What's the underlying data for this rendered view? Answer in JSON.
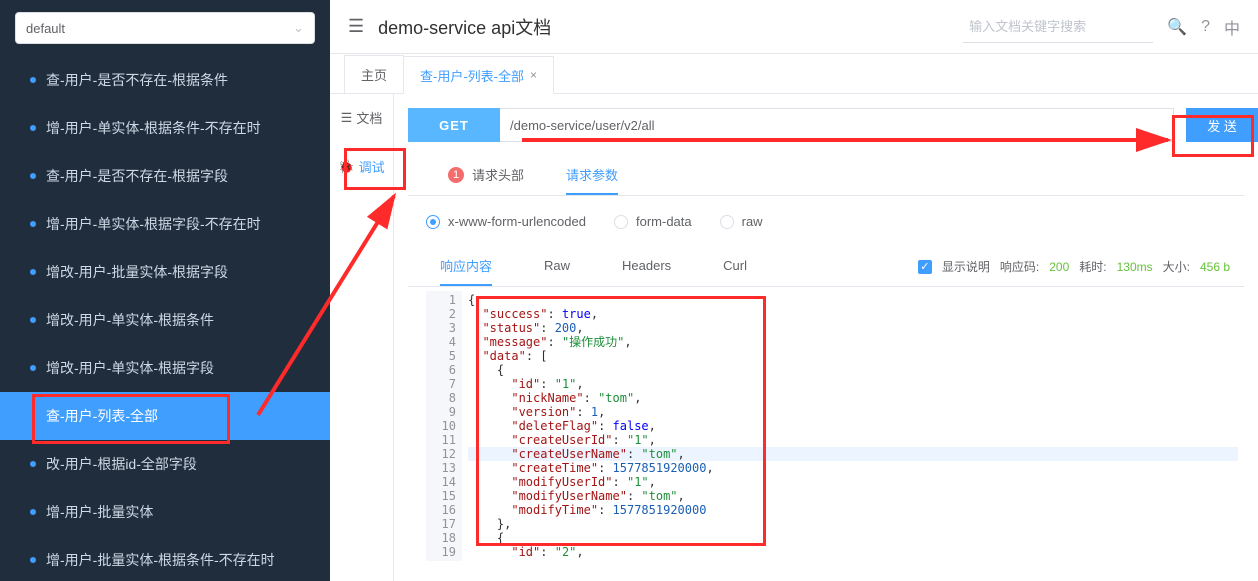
{
  "sidebar": {
    "selector_value": "default",
    "items": [
      "查-用户-是否不存在-根据条件",
      "增-用户-单实体-根据条件-不存在时",
      "查-用户-是否不存在-根据字段",
      "增-用户-单实体-根据字段-不存在时",
      "增改-用户-批量实体-根据字段",
      "增改-用户-单实体-根据条件",
      "增改-用户-单实体-根据字段",
      "查-用户-列表-全部",
      "改-用户-根据id-全部字段",
      "增-用户-批量实体",
      "增-用户-批量实体-根据条件-不存在时"
    ],
    "active_index": 7
  },
  "header": {
    "title": "demo-service api文档",
    "search_placeholder": "输入文档关键字搜索",
    "lang_label": "中"
  },
  "tabs": [
    {
      "label": "主页",
      "closable": false
    },
    {
      "label": "查-用户-列表-全部",
      "closable": true
    }
  ],
  "tabs_active": 1,
  "side_tabs": {
    "doc": "文档",
    "debug": "调试",
    "active": "debug"
  },
  "request": {
    "method": "GET",
    "url": "/demo-service/user/v2/all",
    "send_label": "发 送"
  },
  "param_tabs": {
    "header_label": "请求头部",
    "params_label": "请求参数",
    "badge": "1",
    "active": "params"
  },
  "body_type": {
    "options": [
      "x-www-form-urlencoded",
      "form-data",
      "raw"
    ],
    "selected": 0
  },
  "response_tabs": {
    "labels": [
      "响应内容",
      "Raw",
      "Headers",
      "Curl"
    ],
    "active": 0,
    "show_desc_label": "显示说明",
    "status_label": "响应码:",
    "status_value": "200",
    "time_label": "耗时:",
    "time_value": "130ms",
    "size_label": "大小:",
    "size_value": "456 b"
  },
  "response_body": {
    "success": true,
    "status": 200,
    "message": "操作成功",
    "data": [
      {
        "id": "1",
        "nickName": "tom",
        "version": 1,
        "deleteFlag": false,
        "createUserId": "1",
        "createUserName": "tom",
        "createTime": 1577851920000,
        "modifyUserId": "1",
        "modifyUserName": "tom",
        "modifyTime": 1577851920000
      },
      {
        "id": "2"
      }
    ]
  },
  "code_lines": [
    "{",
    "  \"success\": true,",
    "  \"status\": 200,",
    "  \"message\": \"操作成功\",",
    "  \"data\": [",
    "    {",
    "      \"id\": \"1\",",
    "      \"nickName\": \"tom\",",
    "      \"version\": 1,",
    "      \"deleteFlag\": false,",
    "      \"createUserId\": \"1\",",
    "      \"createUserName\": \"tom\",",
    "      \"createTime\": 1577851920000,",
    "      \"modifyUserId\": \"1\",",
    "      \"modifyUserName\": \"tom\",",
    "      \"modifyTime\": 1577851920000",
    "    },",
    "    {",
    "      \"id\": \"2\","
  ],
  "highlight_line": 12,
  "chart_data": null
}
